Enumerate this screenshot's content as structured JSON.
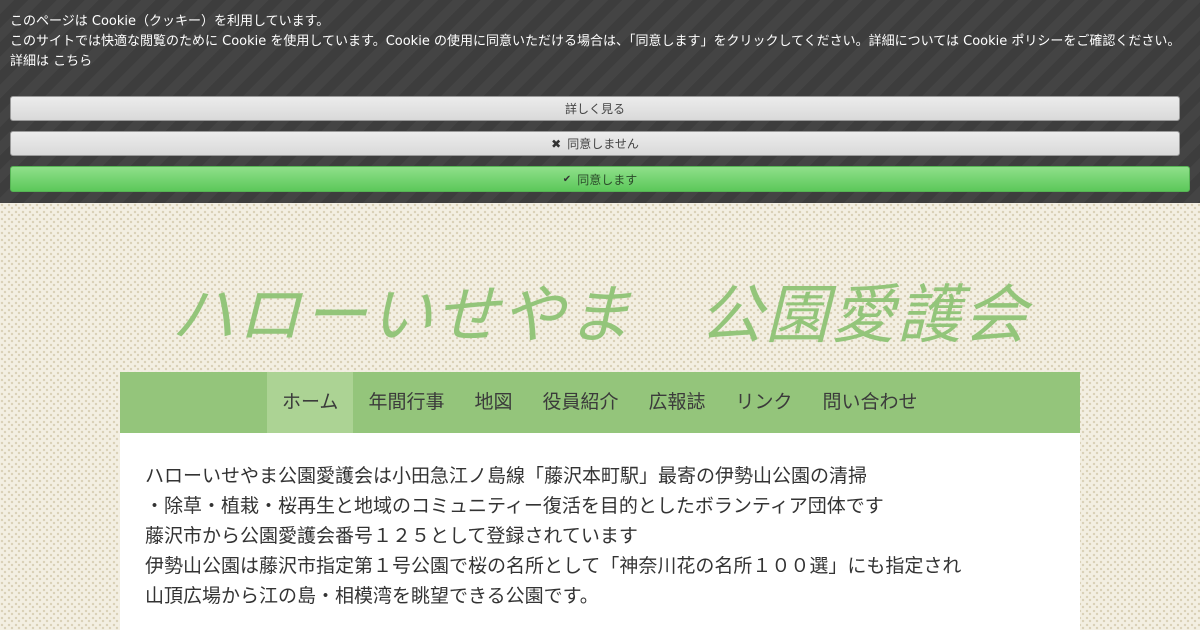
{
  "cookie_banner": {
    "line1": "このページは Cookie（クッキー）を利用しています。",
    "line2": "このサイトでは快適な閲覧のために Cookie を使用しています。Cookie の使用に同意いただける場合は、「同意します」をクリックしてください。詳細については Cookie ポリシーをご確認ください。",
    "line3_prefix": "詳細は",
    "line3_link": "こちら",
    "more_button": "詳しく見る",
    "deny_button": "同意しません",
    "accept_button": "同意します",
    "deny_icon": "✖",
    "accept_icon": "✔"
  },
  "site": {
    "title": "ハローいせやま　公園愛護会"
  },
  "nav": {
    "items": [
      "ホーム",
      "年間行事",
      "地図",
      "役員紹介",
      "広報誌",
      "リンク",
      "問い合わせ"
    ],
    "active": "ホーム"
  },
  "content": {
    "lines": [
      "ハローいせやま公園愛護会は小田急江ノ島線「藤沢本町駅」最寄の伊勢山公園の清掃",
      "・除草・植栽・桜再生と地域のコミュニティー復活を目的としたボランティア団体です",
      "藤沢市から公園愛護会番号１２５として登録されています",
      "伊勢山公園は藤沢市指定第１号公園で桜の名所として「神奈川花の名所１００選」にも指定され",
      "山頂広場から江の島・相模湾を眺望できる公園です。"
    ]
  },
  "colors": {
    "banner_bg": "#3d3d3d",
    "accept_green": "#6fd36b",
    "title_green": "#93c57a",
    "nav_green": "#94c57b",
    "nav_active": "#acd394"
  }
}
